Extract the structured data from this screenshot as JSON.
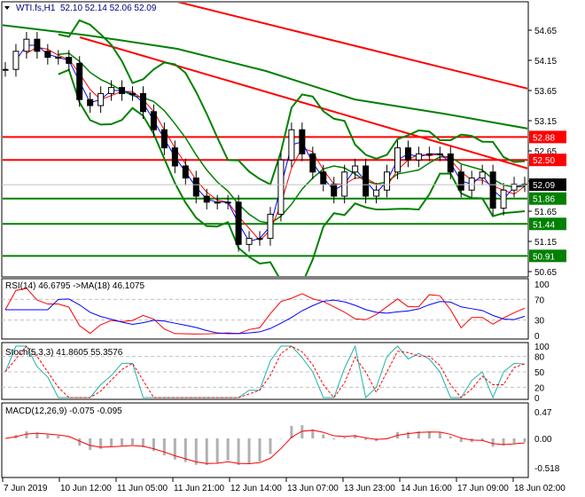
{
  "header": {
    "symbol": "WTI.fs,H1",
    "values": "52.10 52.14 52.06 52.09"
  },
  "indicators": {
    "rsi": {
      "label": "RSI(14) 46.6795  ->MA(18) 46.1075",
      "ticks": [
        "100",
        "70",
        "30",
        "0"
      ]
    },
    "stoch": {
      "label": "Stoch(5,3,3) 41.8605 55.3576",
      "ticks": [
        "100",
        "80",
        "50",
        "20",
        "0"
      ]
    },
    "macd": {
      "label": "MACD(12,26,9) -0.075 -0.095",
      "ticks": [
        "0.47",
        "0.00",
        "-0.518"
      ]
    }
  },
  "chart_data": {
    "type": "line",
    "title": "WTI.fs,H1",
    "yticks": [
      "54.65",
      "54.15",
      "53.65",
      "53.15",
      "52.65",
      "52.15",
      "51.65",
      "51.15",
      "50.65"
    ],
    "ylim": [
      50.6,
      55.1
    ],
    "xticks": [
      "7 Jun 2019",
      "10 Jun 12:00",
      "11 Jun 05:00",
      "11 Jun 21:00",
      "12 Jun 14:00",
      "13 Jun 07:00",
      "13 Jun 23:00",
      "14 Jun 16:00",
      "17 Jun 09:00",
      "18 Jun 02:00"
    ],
    "close": [
      54.0,
      54.3,
      54.5,
      54.3,
      54.2,
      54.2,
      54.1,
      53.5,
      53.4,
      53.6,
      53.7,
      53.6,
      53.6,
      53.3,
      53.0,
      52.7,
      52.4,
      52.2,
      51.9,
      51.8,
      51.8,
      51.8,
      51.1,
      51.2,
      51.2,
      51.6,
      52.5,
      53.0,
      52.6,
      52.3,
      52.1,
      51.9,
      52.3,
      52.4,
      51.9,
      52.0,
      52.3,
      52.7,
      52.5,
      52.6,
      52.6,
      52.6,
      52.3,
      52.0,
      52.2,
      52.3,
      51.7,
      52.0,
      52.1,
      52.09
    ],
    "levels": [
      {
        "label": "52.88",
        "value": 52.88,
        "color": "#ff0000"
      },
      {
        "label": "52.50",
        "value": 52.5,
        "color": "#ff0000"
      },
      {
        "label": "51.86",
        "value": 51.86,
        "color": "#008000"
      },
      {
        "label": "51.44",
        "value": 51.44,
        "color": "#008000"
      },
      {
        "label": "50.91",
        "value": 50.91,
        "color": "#008000"
      }
    ],
    "current": {
      "label": "52.09",
      "value": 52.09
    }
  }
}
